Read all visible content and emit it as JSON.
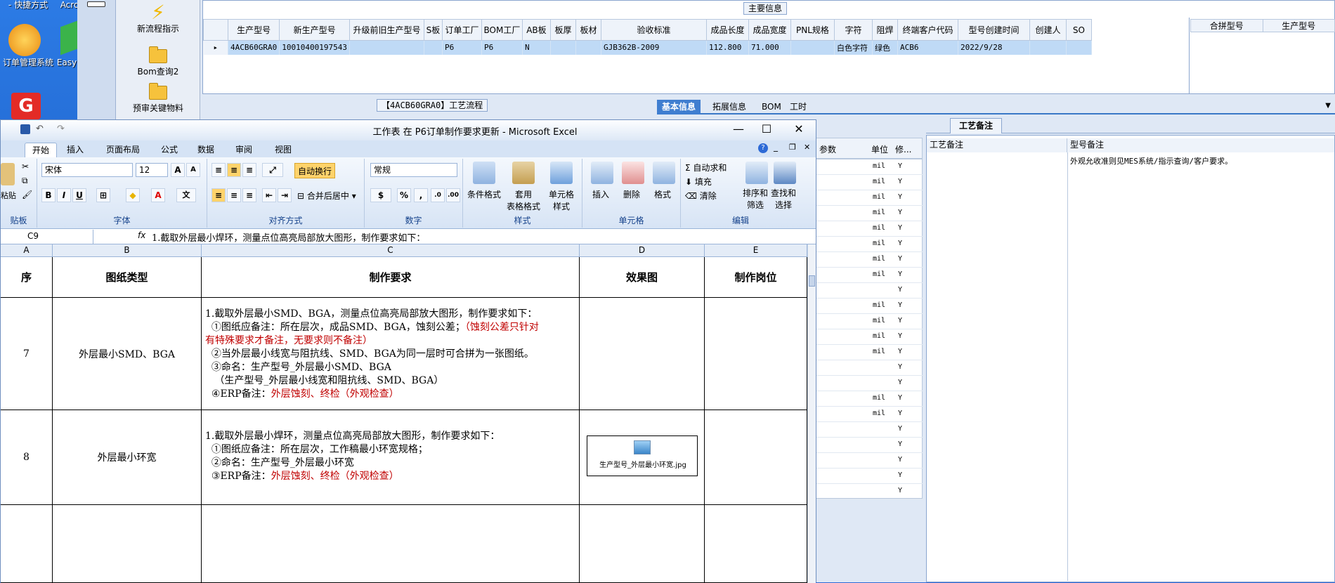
{
  "desktop": {
    "top_text": "- 快捷方式",
    "top_text2": "Acro",
    "icon1": "订单管理系统",
    "icon2": "Easy"
  },
  "nav": {
    "items": [
      "新流程指示",
      "Bom查询2",
      "预审关键物料"
    ]
  },
  "main": {
    "title": "主要信息",
    "columns": [
      "生产型号",
      "新生产型号",
      "升级前旧生产型号",
      "S板",
      "订单工厂",
      "BOM工厂",
      "AB板",
      "板厚",
      "板材",
      "验收标准",
      "成品长度",
      "成品宽度",
      "PNL规格",
      "字符",
      "阻焊",
      "终端客户代码",
      "型号创建时间",
      "创建人",
      "SO"
    ],
    "row": [
      "4ACB60GRA0",
      "10010400197543",
      "",
      "",
      "P6",
      "P6",
      "N",
      "",
      "",
      "GJB362B-2009",
      "112.800",
      "71.000",
      "",
      "白色字符",
      "绿色",
      "ACB6",
      "2022/9/28",
      "",
      ""
    ],
    "right_columns": [
      "合拼型号",
      "生产型号"
    ]
  },
  "proc_header": "【4ACB60GRA0】工艺流程",
  "tabs": [
    "基本信息",
    "拓展信息",
    "BOM",
    "工时"
  ],
  "param_table": {
    "headers": [
      "参数",
      "单位",
      "修..."
    ],
    "rows": [
      [
        "mil",
        "Y"
      ],
      [
        "mil",
        "Y"
      ],
      [
        "mil",
        "Y"
      ],
      [
        "mil",
        "Y"
      ],
      [
        "mil",
        "Y"
      ],
      [
        "mil",
        "Y"
      ],
      [
        "mil",
        "Y"
      ],
      [
        "mil",
        "Y"
      ],
      [
        "",
        "Y"
      ],
      [
        "mil",
        "Y"
      ],
      [
        "mil",
        "Y"
      ],
      [
        "mil",
        "Y"
      ],
      [
        "mil",
        "Y"
      ],
      [
        "",
        "Y"
      ],
      [
        "",
        "Y"
      ],
      [
        "mil",
        "Y"
      ],
      [
        "mil",
        "Y"
      ],
      [
        "",
        "Y"
      ],
      [
        "",
        "Y"
      ],
      [
        "",
        "Y"
      ],
      [
        "",
        "Y"
      ],
      [
        "",
        "Y"
      ]
    ]
  },
  "remark": {
    "tab": "工艺备注",
    "col1": "工艺备注",
    "col2": "型号备注",
    "note": "外观允收准则见MES系统/指示查询/客户要求。"
  },
  "excel": {
    "title": "工作表 在 P6订单制作要求更新 - Microsoft Excel",
    "tabs": [
      "开始",
      "插入",
      "页面布局",
      "公式",
      "数据",
      "审阅",
      "视图"
    ],
    "font_name": "宋体",
    "font_size": "12",
    "number_format": "常规",
    "wrap_label": "自动换行",
    "merge_label": "合并后居中",
    "groups": [
      "贴板",
      "字体",
      "对齐方式",
      "数字",
      "样式",
      "单元格",
      "编辑"
    ],
    "paste_label": "粘贴",
    "style_buttons": [
      "条件格式",
      "套用\n表格格式",
      "单元格\n样式"
    ],
    "cell_buttons": [
      "插入",
      "删除",
      "格式"
    ],
    "edit_buttons": [
      "自动求和",
      "填充",
      "清除",
      "排序和\n筛选",
      "查找和\n选择"
    ],
    "name_box": "C9",
    "fx": "fx",
    "formula": "1.截取外层最小焊环，测量点位高亮局部放大图形，制作要求如下：",
    "col_letters": [
      "A",
      "B",
      "C",
      "D",
      "E"
    ],
    "headers": [
      "序",
      "图纸类型",
      "制作要求",
      "效果图",
      "制作岗位"
    ],
    "rows": [
      {
        "no": "7",
        "type": "外层最小SMD、BGA",
        "lines": [
          [
            {
              "t": "1.截取外层最小SMD、BGA，测量点位高亮局部放大图形，制作要求如下："
            }
          ],
          [
            {
              "t": "  ①图纸应备注：所在层次，成品SMD、BGA，蚀刻公差；"
            },
            {
              "t": "（蚀刻公差只针对",
              "c": "red"
            }
          ],
          [
            {
              "t": "有特殊要求才备注，无要求则不备注）",
              "c": "red"
            }
          ],
          [
            {
              "t": "  ②当外层最小线宽与阻抗线、SMD、BGA为同一层时可合拼为一张图纸。"
            }
          ],
          [
            {
              "t": "  ③命名：生产型号_外层最小SMD、BGA"
            }
          ],
          [
            {
              "t": "   （生产型号_外层最小线宽和阻抗线、SMD、BGA）"
            }
          ],
          [
            {
              "t": "  ④ERP备注："
            },
            {
              "t": "外层蚀刻、终检（外观检查）",
              "c": "red"
            }
          ]
        ]
      },
      {
        "no": "8",
        "type": "外层最小环宽",
        "image": "生产型号_外层最小环宽.jpg",
        "lines": [
          [
            {
              "t": "1.截取外层最小焊环，测量点位高亮局部放大图形，制作要求如下："
            }
          ],
          [
            {
              "t": "  ①图纸应备注：所在层次，工作稿最小环宽规格；"
            }
          ],
          [
            {
              "t": "  ②命名：生产型号_外层最小环宽"
            }
          ],
          [
            {
              "t": "  ③ERP备注："
            },
            {
              "t": "外层蚀刻、终检（外观检查）",
              "c": "red"
            }
          ]
        ]
      }
    ]
  }
}
